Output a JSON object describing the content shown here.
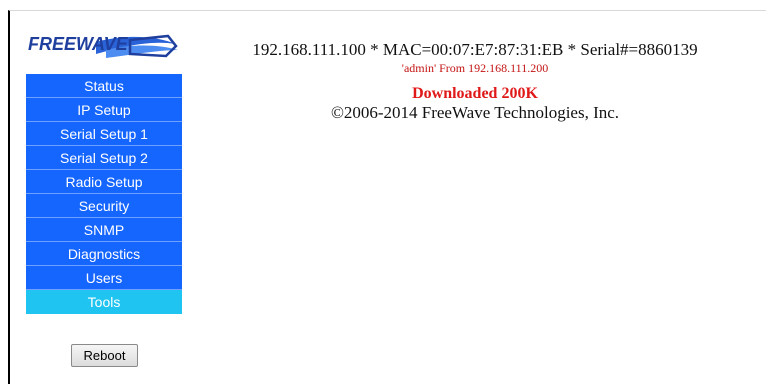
{
  "brand": {
    "logo_text": "FREEWAVE"
  },
  "device": {
    "info_line": "192.168.111.100 * MAC=00:07:E7:87:31:EB * Serial#=8860139",
    "login_line": "'admin' From 192.168.111.200",
    "status_line": "Downloaded 200K",
    "copyright_line": "©2006-2014 FreeWave Technologies, Inc."
  },
  "sidebar": {
    "items": [
      {
        "label": "Status",
        "active": false
      },
      {
        "label": "IP Setup",
        "active": false
      },
      {
        "label": "Serial Setup 1",
        "active": false
      },
      {
        "label": "Serial Setup 2",
        "active": false
      },
      {
        "label": "Radio Setup",
        "active": false
      },
      {
        "label": "Security",
        "active": false
      },
      {
        "label": "SNMP",
        "active": false
      },
      {
        "label": "Diagnostics",
        "active": false
      },
      {
        "label": "Users",
        "active": false
      },
      {
        "label": "Tools",
        "active": true
      }
    ]
  },
  "actions": {
    "reboot_label": "Reboot"
  },
  "colors": {
    "nav_bg": "#1565ff",
    "nav_active_bg": "#1fc4f0",
    "status_text": "#e01818",
    "login_text": "#c51414",
    "logo_blue": "#1f3f9e"
  }
}
